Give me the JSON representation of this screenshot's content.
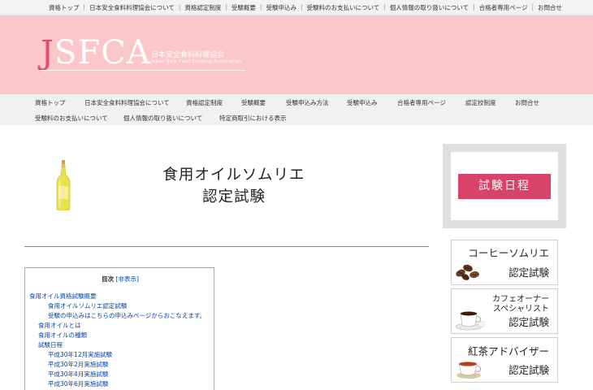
{
  "topbar": {
    "links": [
      "資格トップ",
      "日本安全食料料理協会について",
      "資格認定制度",
      "受験概要",
      "受験申込み",
      "受験料のお支払いについて",
      "個人情報の取り扱いについて",
      "合格者専用ページ",
      "お問合せ"
    ]
  },
  "logo": {
    "initial": "J",
    "rest": "SFCA",
    "ja": "日本安全食料料理協会",
    "en": "Japan Safe Food Cooking Association"
  },
  "nav": {
    "row1": [
      "資格トップ",
      "日本安全食料料理協会について",
      "資格認定制度",
      "受験概要",
      "受験申込み方法",
      "受験申込み",
      "合格者専用ページ",
      "認定校制度",
      "お問合せ"
    ],
    "row2": [
      "受験料のお支払いについて",
      "個人情報の取り扱いについて",
      "特定商取引における表示"
    ]
  },
  "main": {
    "title_line1": "食用オイルソムリエ",
    "title_line2": "認定試験"
  },
  "toc": {
    "label": "目次",
    "toggle": "[非表示]",
    "items": [
      "食用オイル資格試験概要",
      "食用オイルソムリエ認定試験",
      "受験の申込みはこちらの申込みページからおこなえます。",
      "食用オイルとは",
      "食用オイルの種類",
      "試験日程",
      "平成30年12月実施試験",
      "平成30年2月実施試験",
      "平成30年4月実施試験",
      "平成30年6月実施試験"
    ]
  },
  "sidebar": {
    "exam_schedule": "試験日程",
    "cards": [
      {
        "line1": "コーヒーソムリエ",
        "line2": "認定試験"
      },
      {
        "line1": "カフェオーナー",
        "line1b": "スペシャリスト",
        "line2": "認定試験"
      },
      {
        "line1": "紅茶アドバイザー",
        "line2": "認定試験"
      }
    ]
  },
  "colors": {
    "header_bg": "#fcc7c9",
    "logo_accent": "#e64b6d",
    "button": "#d9436a",
    "link": "#0645ad"
  }
}
